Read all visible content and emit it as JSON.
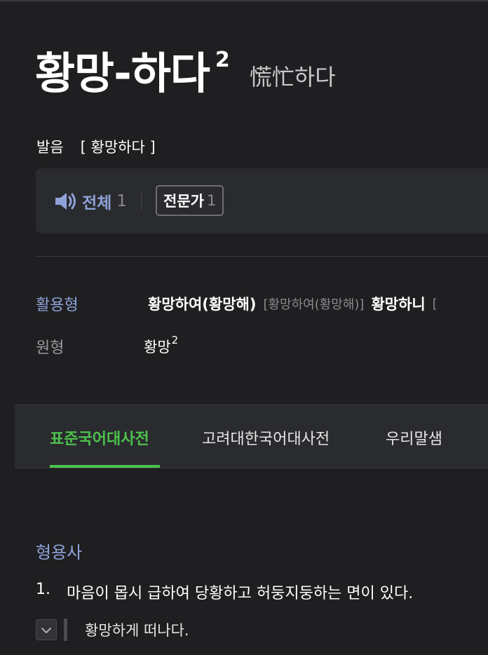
{
  "entry": {
    "headword": "황망-하다",
    "homonym_number": "2",
    "hanja": "慌忙하다"
  },
  "pronunciation": {
    "label": "발음",
    "value": "[ 황망하다 ]"
  },
  "audio": {
    "all_label": "전체",
    "all_count": "1",
    "expert_label": "전문가",
    "expert_count": "1",
    "icon": "speaker-icon"
  },
  "conjugation": {
    "label": "활용형",
    "forms": [
      {
        "form": "황망하여(황망해)",
        "pron": "[황망하여(황망해)]"
      },
      {
        "form": "황망하니",
        "pron": "["
      }
    ]
  },
  "base_form": {
    "label": "원형",
    "word": "황망",
    "superscript": "2"
  },
  "tabs": [
    {
      "label": "표준국어대사전",
      "active": true
    },
    {
      "label": "고려대한국어대사전",
      "active": false
    },
    {
      "label": "우리말샘",
      "active": false
    }
  ],
  "definition": {
    "pos": "형용사",
    "number": "1.",
    "text": "마음이 몹시 급하여 당황하고 허둥지둥하는 면이 있다.",
    "example": "황망하게 떠나다."
  },
  "colors": {
    "background": "#1f1f21",
    "accent_blue": "#8ea3d8",
    "accent_green": "#4cc24c",
    "panel": "#2a2b2e"
  }
}
